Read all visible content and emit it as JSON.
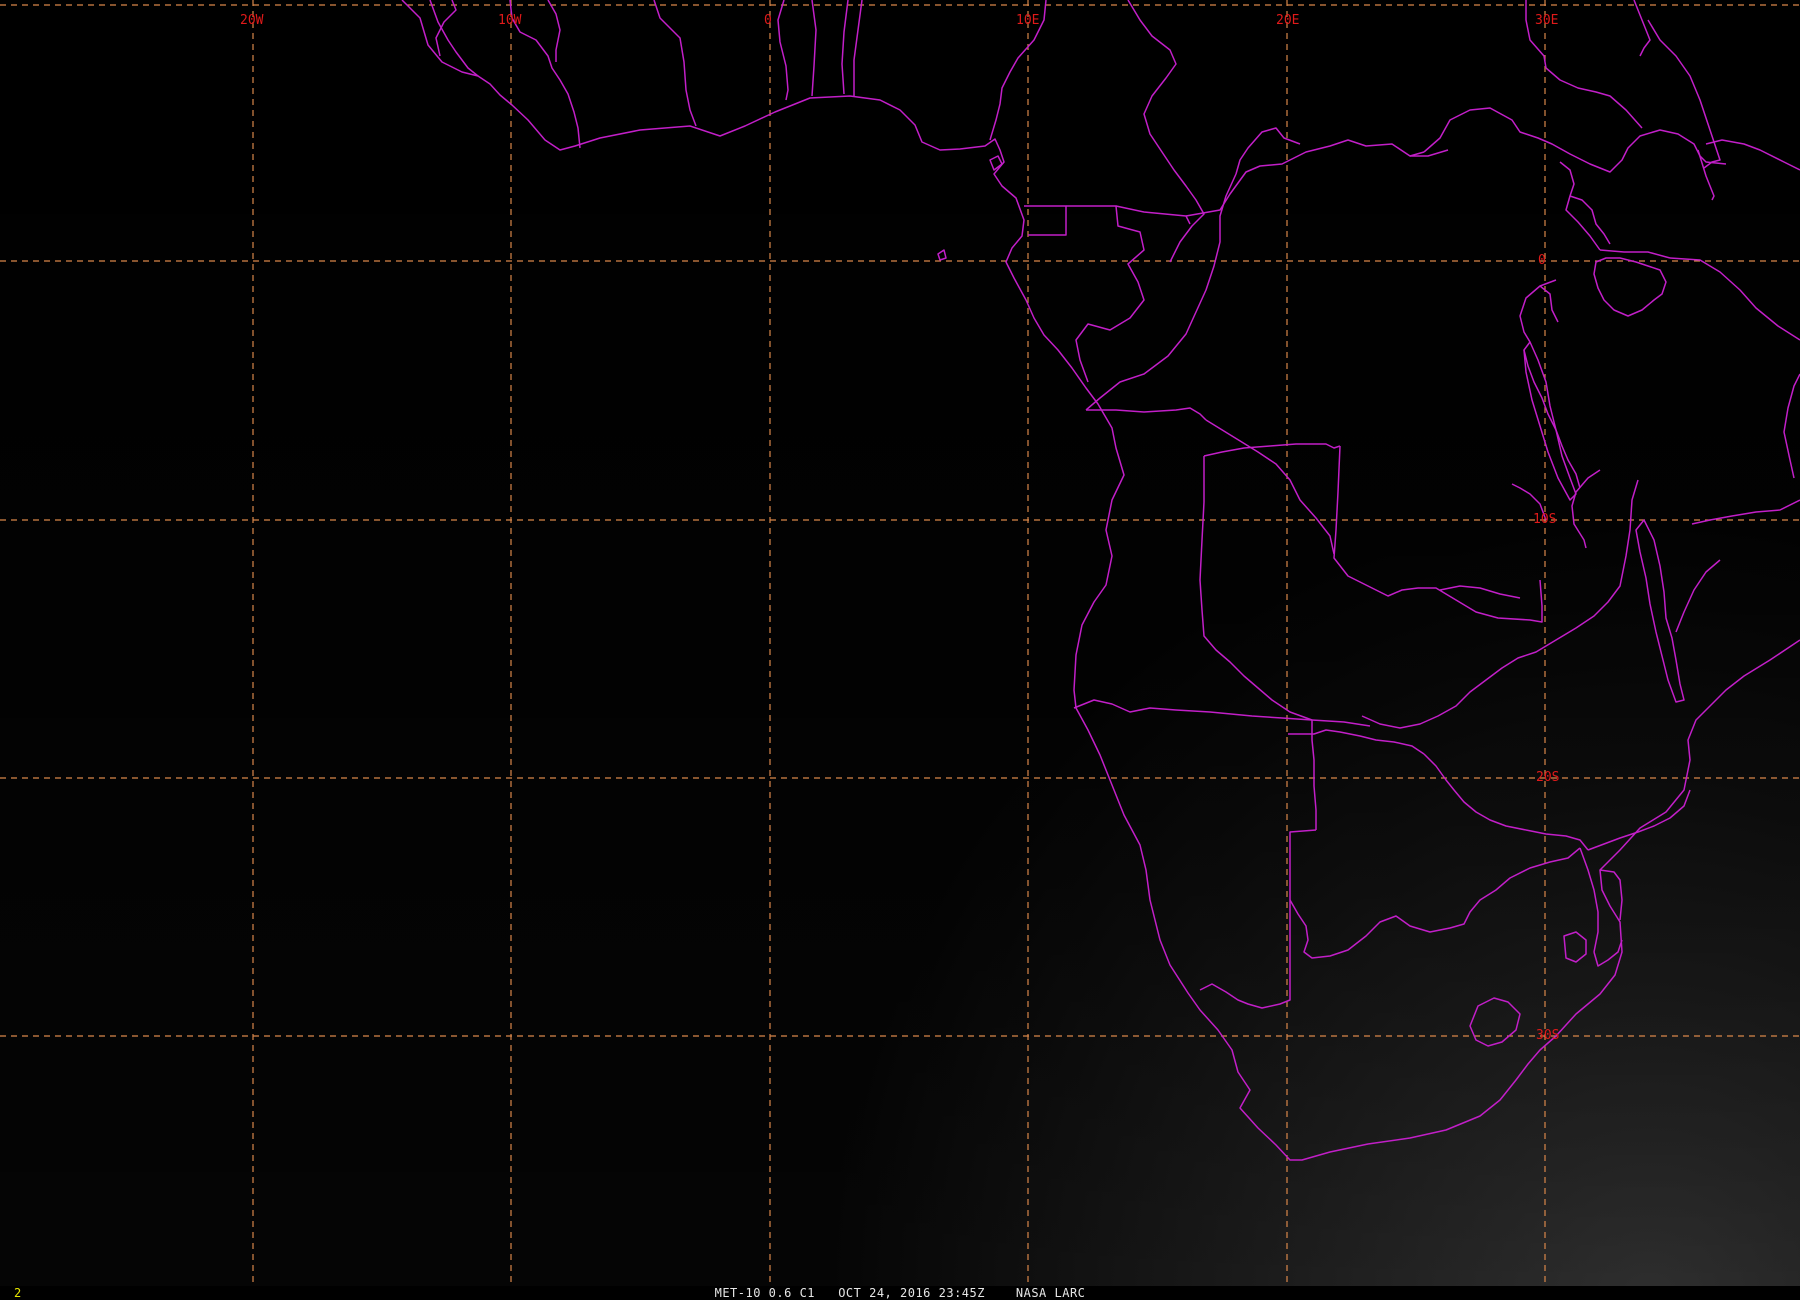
{
  "colors": {
    "grid": "#d9874a",
    "grid_label": "#e01a1a",
    "coastline": "#c21fc8",
    "status_text": "#e6e6e6",
    "frame_number": "#e6e600"
  },
  "grid": {
    "longitude_labels": [
      "20W",
      "10W",
      "0",
      "10E",
      "20E",
      "30E"
    ],
    "latitude_labels": [
      "0",
      "10S",
      "20S",
      "30S"
    ]
  },
  "status": {
    "frame_number": "2",
    "caption": "MET-10 0.6 C1   OCT 24, 2016 23:45Z    NASA LARC"
  }
}
